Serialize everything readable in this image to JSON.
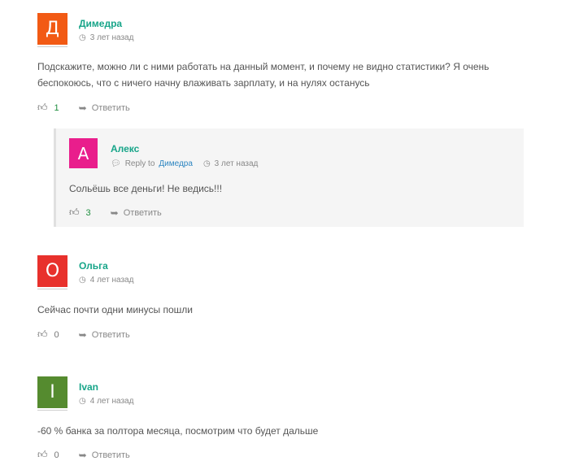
{
  "comments": [
    {
      "avatar_letter": "Д",
      "avatar_color": "#f25a14",
      "author": "Димедра",
      "time": "3 лет назад",
      "text_line1": "Подскажите, можно ли с ними работать на данный момент, и почему не видно статистики? Я очень",
      "text_line2": "беспокоюсь, что с ничего начну влаживать зарплату, и на нулях останусь",
      "likes": "1",
      "reply_label": "Ответить"
    },
    {
      "avatar_letter": "О",
      "avatar_color": "#e8312c",
      "author": "Ольга",
      "time": "4 лет назад",
      "text_line1": "Сейчас почти одни минусы пошли",
      "likes": "0",
      "reply_label": "Ответить"
    },
    {
      "avatar_letter": "I",
      "avatar_color": "#558b2f",
      "author": "Ivan",
      "time": "4 лет назад",
      "text_line1": "-60 % банка за полтора месяца, посмотрим что будет дальше",
      "likes": "0",
      "reply_label": "Ответить"
    }
  ],
  "reply": {
    "avatar_letter": "А",
    "avatar_color": "#e91e8c",
    "author": "Алекс",
    "reply_to_label": "Reply to",
    "reply_to": "Димедра",
    "time": "3 лет назад",
    "text": "Сольёшь все деньги! Не ведись!!!",
    "likes": "3",
    "reply_label": "Ответить"
  },
  "icons": {
    "like": "thumbs-up-icon",
    "reply": "reply-arrow-icon",
    "clock": "clock-icon",
    "comment": "speech-bubble-icon"
  }
}
